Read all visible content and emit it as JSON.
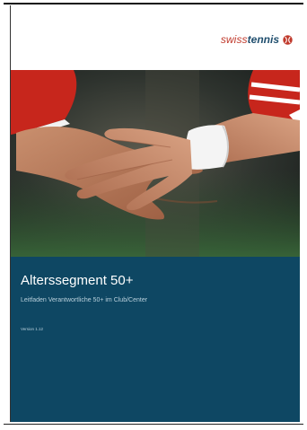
{
  "brand": {
    "logo_swiss": "swiss",
    "logo_tennis": "tennis",
    "accent_color": "#c0392b",
    "brand_color": "#1f4e6e"
  },
  "cover": {
    "title": "Alterssegment 50+",
    "subtitle": "Leitfaden Verantwortliche 50+ im Club/Center",
    "version": "Version 1.12",
    "panel_color": "#0e4763"
  }
}
